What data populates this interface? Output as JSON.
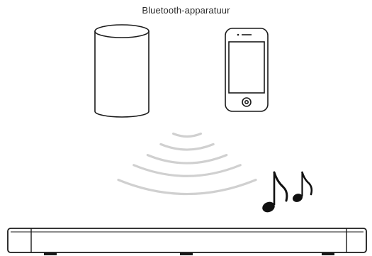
{
  "caption": "Bluetooth-apparatuur",
  "devices": {
    "speaker": "speaker-icon",
    "phone": "smartphone-icon",
    "soundbar": "soundbar-icon"
  },
  "signal": {
    "icon": "bluetooth-signal-waves-icon",
    "color": "#d0d0d0"
  },
  "music": {
    "icon": "music-notes-icon",
    "color": "#111111"
  }
}
